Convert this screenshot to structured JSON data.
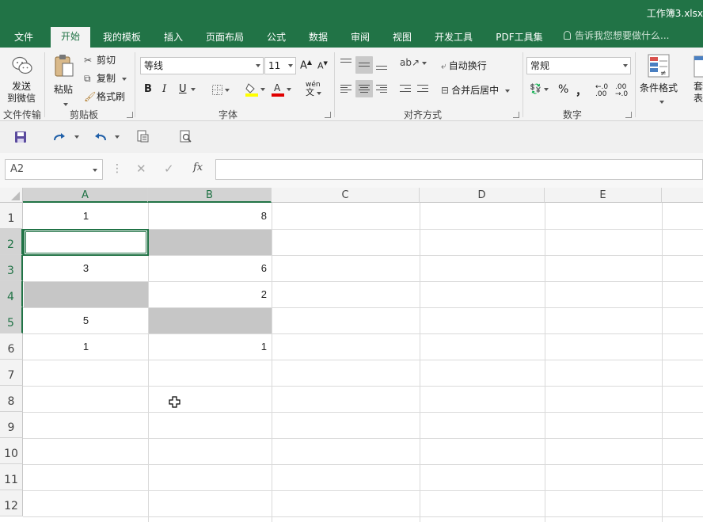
{
  "window": {
    "title": "工作簿3.xlsx"
  },
  "tabs": [
    "文件",
    "开始",
    "我的模板",
    "插入",
    "页面布局",
    "公式",
    "数据",
    "审阅",
    "视图",
    "开发工具",
    "PDF工具集"
  ],
  "active_tab": "开始",
  "tellme": "告诉我您想要做什么...",
  "ribbon": {
    "send_line1": "发送",
    "send_line2": "到微信",
    "group_wechat": "文件传输",
    "paste": "粘贴",
    "cut": "剪切",
    "copy": "复制",
    "format_painter": "格式刷",
    "group_clipboard": "剪贴板",
    "font_name": "等线",
    "font_size": "11",
    "bold": "B",
    "italic": "I",
    "underline": "U",
    "wen": "wén",
    "group_font": "字体",
    "wrap_text": "自动换行",
    "merge_center": "合并后居中",
    "group_alignment": "对齐方式",
    "number_format": "常规",
    "percent": "%",
    "comma": "，",
    "group_number": "数字",
    "cond_format": "条件格式",
    "table_format_partial": "套\n表格格"
  },
  "namebox": "A2",
  "fx": "fx",
  "formula_value": "",
  "columns": [
    "A",
    "B",
    "C",
    "D",
    "E"
  ],
  "rows": [
    "1",
    "2",
    "3",
    "4",
    "5",
    "6",
    "7",
    "8",
    "9",
    "10",
    "11",
    "12"
  ],
  "cells": {
    "A1": "1",
    "B1": "8",
    "A3": "3",
    "B3": "6",
    "B4": "2",
    "A5": "5",
    "A6": "1",
    "B6": "1"
  },
  "colors": {
    "excel_green": "#217346",
    "gray_fill": "#c6c6c6"
  }
}
